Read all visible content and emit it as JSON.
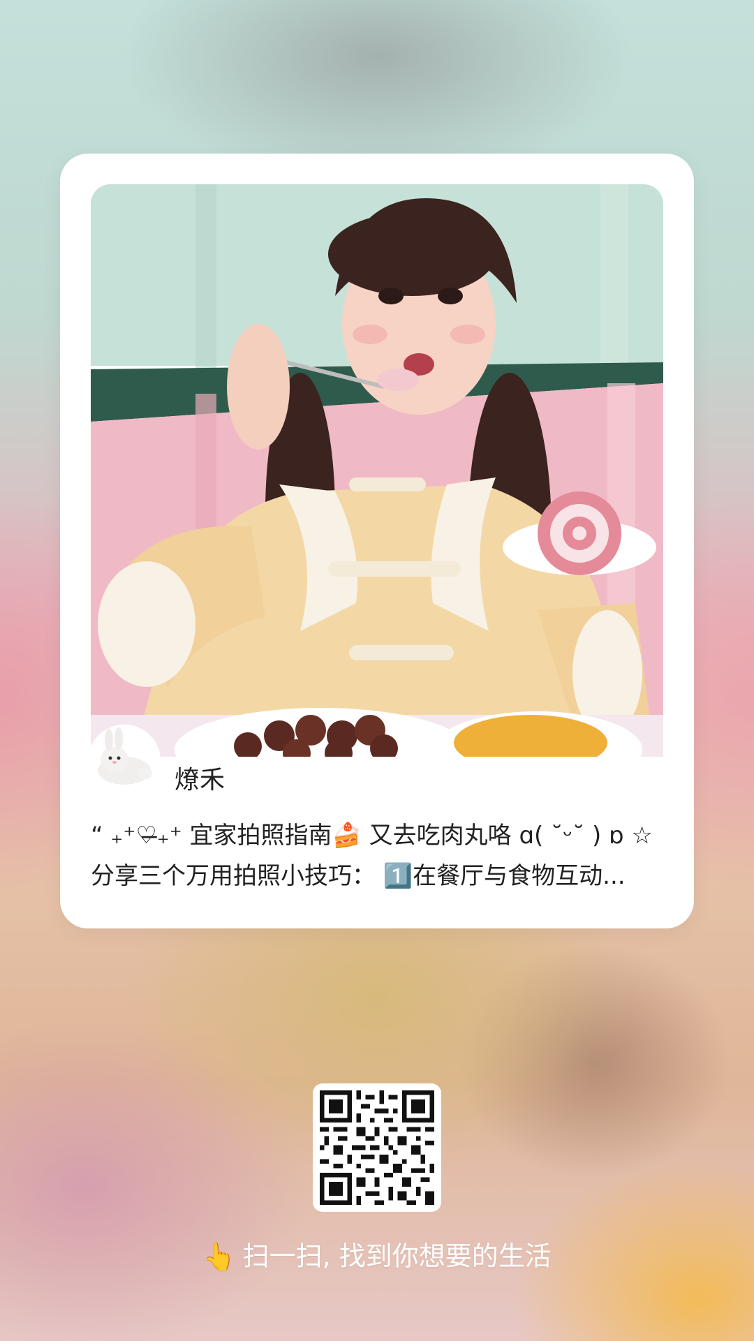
{
  "card": {
    "author_name": "燎禾",
    "description_line1": "“ ₊⁺♡̶₊⁺ 宜家拍照指南🍰 又去吃肉丸咯 ɑ( ˘ᵕ˘ ) ɒ ☆",
    "description_line2": "分享三个万用拍照小技巧： 1️⃣在餐厅与食物互动..."
  },
  "footer": {
    "hand_icon": "👆",
    "scan_text": "扫一扫, 找到你想要的生活"
  }
}
